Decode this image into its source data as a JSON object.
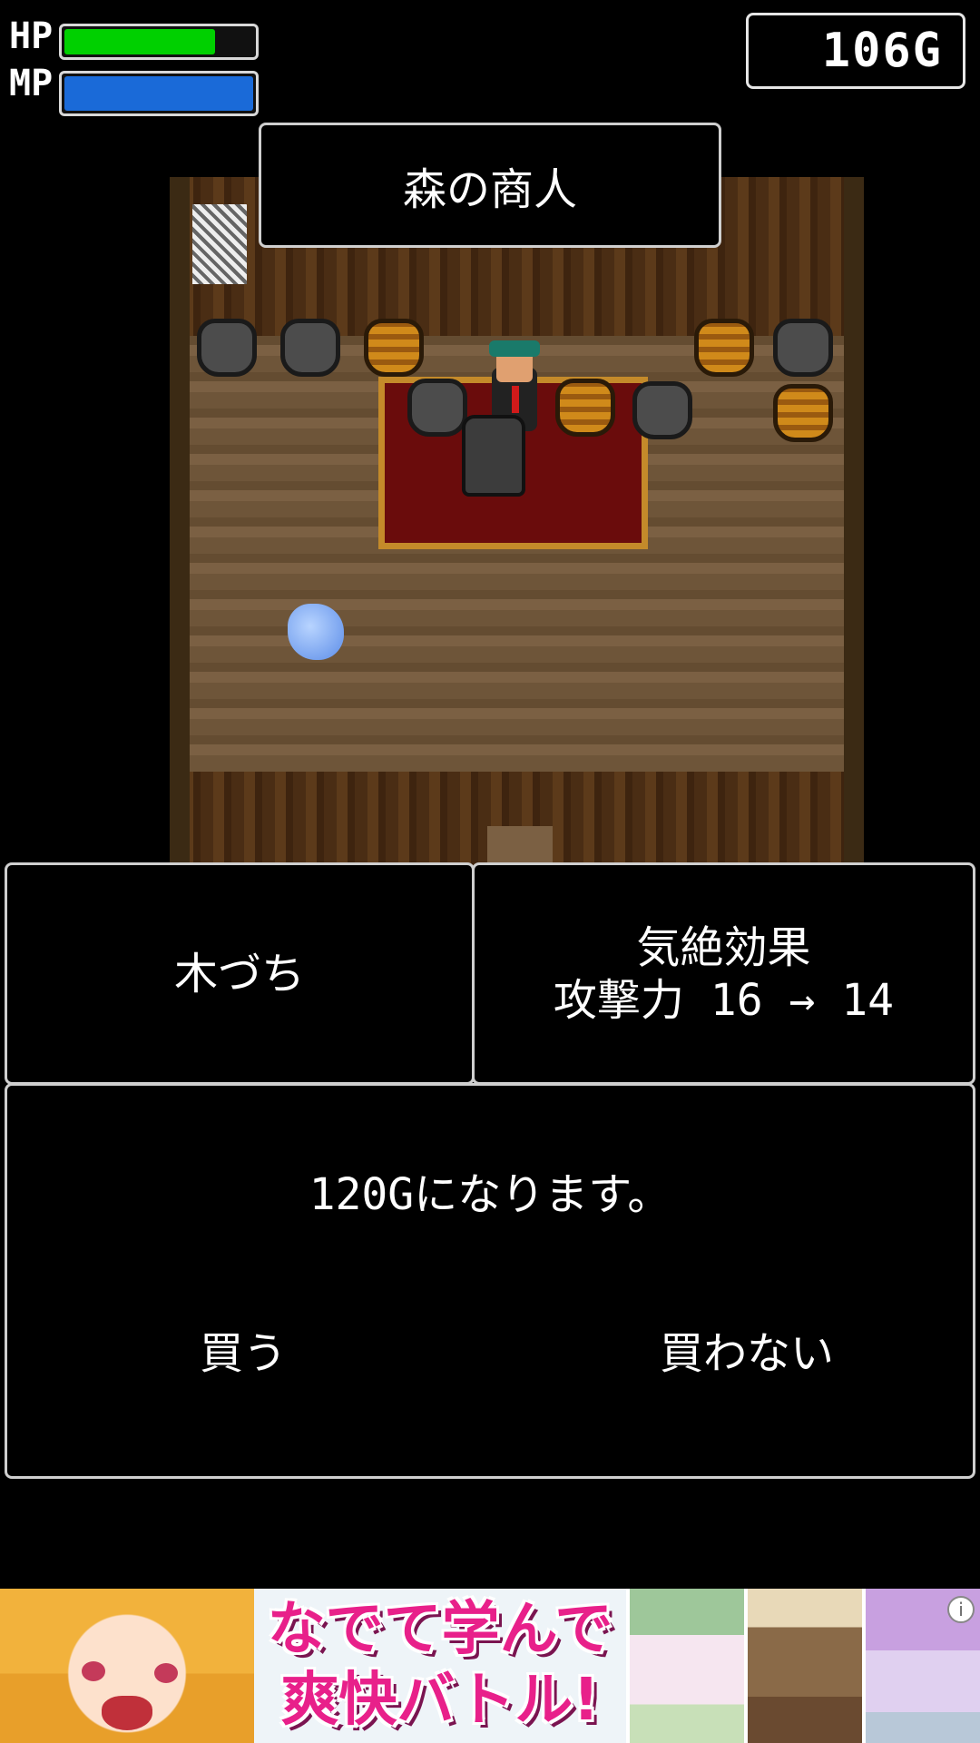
{
  "hud": {
    "hp_label": "HP",
    "mp_label": "MP",
    "hp_fraction": 0.8,
    "mp_fraction": 1.0,
    "hp_color": "#00d000",
    "mp_color": "#1a6ad8",
    "gold": "106G"
  },
  "location": {
    "name": "森の商人"
  },
  "shop": {
    "item_name": "木づち",
    "item_effect": "気絶効果",
    "item_stat": "攻撃力 16 → 14",
    "price_message": "120Gになります。",
    "buy_label": "買う",
    "decline_label": "買わない"
  },
  "ad": {
    "headline_1": "なでて学んで",
    "headline_2": "爽快バトル!",
    "info_icon": "info-icon",
    "info_glyph": "i"
  }
}
